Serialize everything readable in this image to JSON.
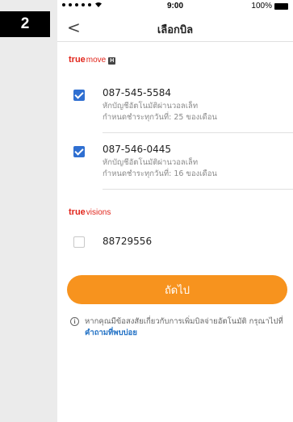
{
  "step_badge": "2",
  "statusbar": {
    "time": "9:00",
    "battery": "100%"
  },
  "navbar": {
    "back_glyph": "<",
    "title": "เลือกบิล"
  },
  "truemove": {
    "brand_main": "true",
    "brand_sub": "move",
    "brand_badge": "H",
    "items": [
      {
        "checked": true,
        "number": "087-545-5584",
        "line1": "หักบัญชีอัตโนมัติผ่านวอลเล็ท",
        "line2": "กำหนดชำระทุกวันที่: 25 ของเดือน"
      },
      {
        "checked": true,
        "number": "087-546-0445",
        "line1": "หักบัญชีอัตโนมัติผ่านวอลเล็ท",
        "line2": "กำหนดชำระทุกวันที่: 16 ของเดือน"
      }
    ]
  },
  "truevisions": {
    "brand_main": "true",
    "brand_sub": "visions",
    "items": [
      {
        "checked": false,
        "number": "88729556"
      }
    ]
  },
  "next_button": "ถัดไป",
  "info": {
    "icon": "i",
    "text": "หากคุณมีข้อสงสัยเกี่ยวกับการเพิ่มบิลจ่ายอัตโนมัติ กรุณาไปที่",
    "link": "คำถามที่พบบ่อย"
  },
  "colors": {
    "accent": "#f7931e",
    "checkbox": "#2f6fd1",
    "brand": "#e1251b",
    "link": "#1e6fc4"
  }
}
